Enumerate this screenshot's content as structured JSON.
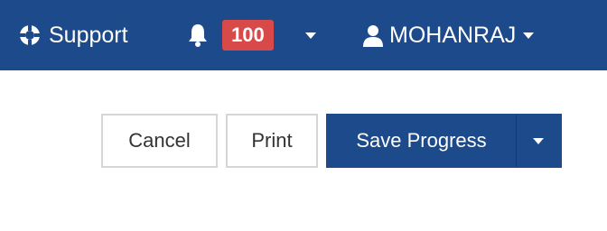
{
  "colors": {
    "header_bg": "#1d4a8a",
    "badge_bg": "#d84a4a",
    "primary_btn": "#1d4a8a"
  },
  "header": {
    "support": {
      "label": "Support",
      "icon": "life-ring-icon"
    },
    "notifications": {
      "icon": "bell-icon",
      "count": "100",
      "dropdown_icon": "caret-down-icon"
    },
    "user": {
      "icon": "user-icon",
      "name": "MOHANRAJ",
      "dropdown_icon": "caret-down-icon"
    }
  },
  "actions": {
    "cancel_label": "Cancel",
    "print_label": "Print",
    "save_label": "Save Progress",
    "save_dropdown_icon": "caret-down-icon"
  }
}
